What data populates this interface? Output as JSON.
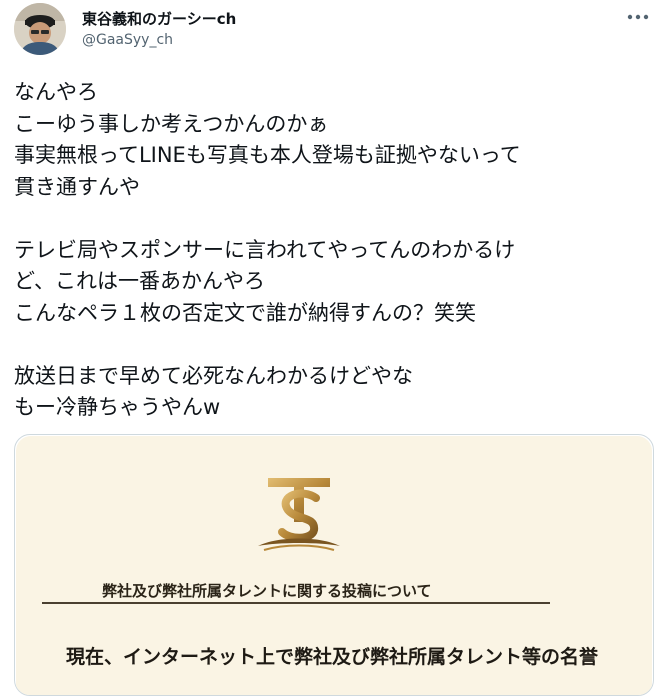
{
  "tweet": {
    "author": {
      "display_name": "東谷義和のガーシーch",
      "handle": "@GaaSyy_ch"
    },
    "more_icon": "more-horizontal-icon",
    "text_lines": [
      "なんやろ",
      "こーゆう事しか考えつかんのかぁ",
      "事実無根ってLINEも写真も本人登場も証拠やないって",
      "貫き通すんや",
      "",
      "テレビ局やスポンサーに言われてやってんのわかるけ",
      "ど、これは一番あかんやろ",
      "こんなペラ１枚の否定文で誰が納得すんの？笑笑",
      "",
      "放送日まで早めて必死なんわかるけどやな",
      "もー冷静ちゃうやんw"
    ]
  },
  "media": {
    "logo_icon": "company-ts-logo-icon",
    "document_title": "弊社及び弊社所属タレントに関する投稿について",
    "document_body_first_line": "現在、インターネット上で弊社及び弊社所属タレント等の名誉"
  },
  "colors": {
    "text": "#0f1419",
    "secondary_text": "#536471",
    "card_border": "#cfd9de",
    "document_background": "#faf4e4",
    "logo_gold": "#b8893a"
  }
}
